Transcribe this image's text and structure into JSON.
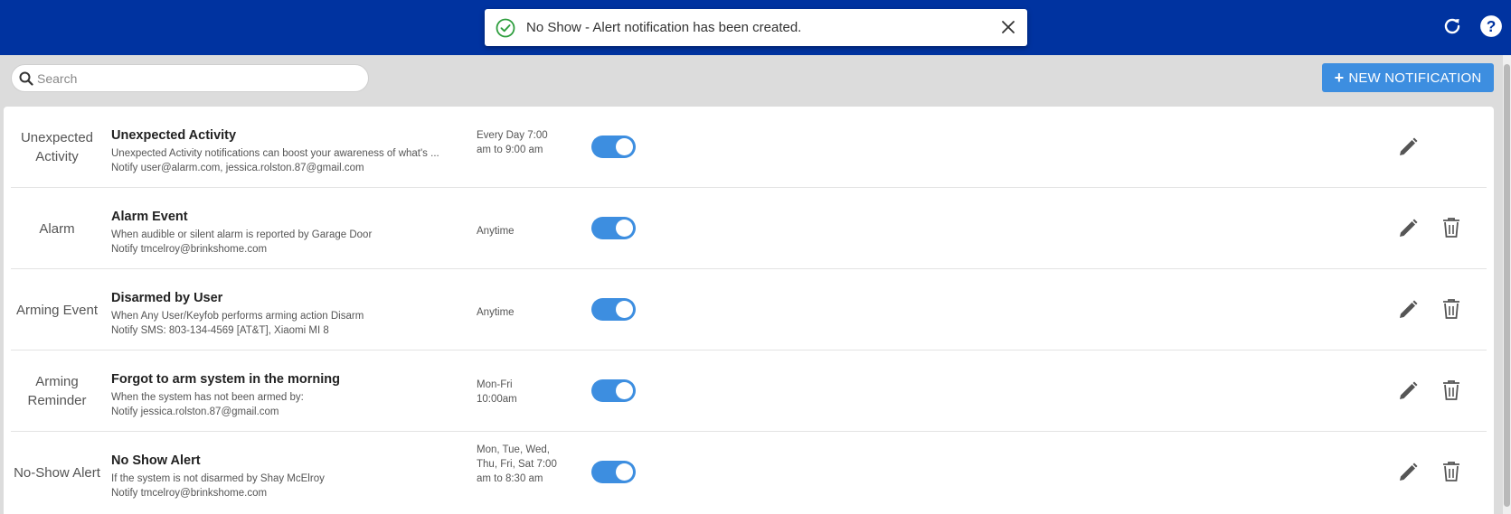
{
  "toast": {
    "message": "No Show - Alert notification has been created.",
    "icon": "check-circle-icon",
    "close_icon": "close-icon"
  },
  "header": {
    "refresh_icon": "refresh-icon",
    "help_icon": "help-icon"
  },
  "search": {
    "placeholder": "Search",
    "value": ""
  },
  "new_notification_label": "NEW NOTIFICATION",
  "colors": {
    "header": "#0033a0",
    "accent": "#3d8ee0",
    "success": "#2e9e3e"
  },
  "rows": [
    {
      "category": "Unexpected Activity",
      "title": "Unexpected Activity",
      "desc1": "Unexpected Activity notifications can boost your awareness of what's ...",
      "desc2": "Notify user@alarm.com, jessica.rolston.87@gmail.com",
      "schedule": "Every Day 7:00 am to 9:00 am",
      "enabled": true,
      "deletable": false
    },
    {
      "category": "Alarm",
      "title": "Alarm Event",
      "desc1": "When audible or silent alarm is reported by Garage Door",
      "desc2": "Notify tmcelroy@brinkshome.com",
      "schedule": "Anytime",
      "enabled": true,
      "deletable": true
    },
    {
      "category": "Arming Event",
      "title": "Disarmed by User",
      "desc1": "When Any User/Keyfob performs arming action Disarm",
      "desc2": "Notify SMS: 803-134-4569 [AT&T], Xiaomi MI 8",
      "schedule": "Anytime",
      "enabled": true,
      "deletable": true
    },
    {
      "category": "Arming Reminder",
      "title": "Forgot to arm system in the morning",
      "desc1": "When the system has not been armed by:",
      "desc2": "Notify jessica.rolston.87@gmail.com",
      "schedule": "Mon-Fri 10:00am",
      "enabled": true,
      "deletable": true
    },
    {
      "category": "No-Show Alert",
      "title": "No Show Alert",
      "desc1": "If the system is not disarmed by Shay McElroy",
      "desc2": "Notify tmcelroy@brinkshome.com",
      "schedule": "Mon, Tue, Wed, Thu, Fri, Sat 7:00 am to 8:30 am",
      "enabled": true,
      "deletable": true
    }
  ]
}
